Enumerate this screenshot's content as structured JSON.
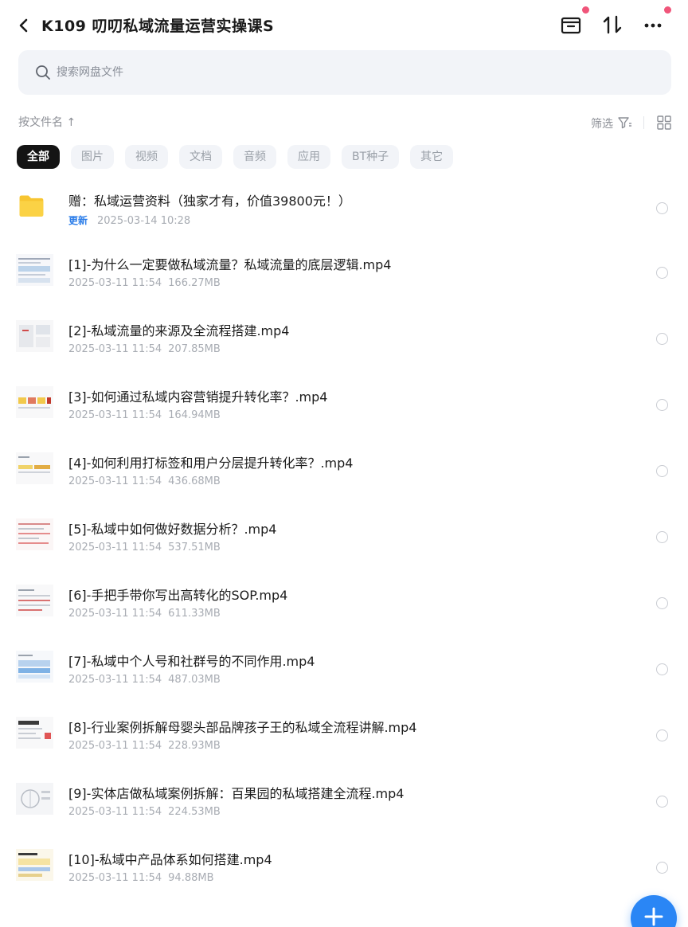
{
  "header": {
    "title": "K109 叨叨私域流量运营实操课S",
    "icons": [
      "back-arrow-icon",
      "archive-box-icon",
      "sort-arrows-icon",
      "more-dots-icon"
    ],
    "badge_color": "#f0557a"
  },
  "search": {
    "placeholder": "搜索网盘文件",
    "value": ""
  },
  "toolbar": {
    "sort_label": "按文件名 ↑",
    "filter_label": "筛选"
  },
  "chips": [
    {
      "label": "全部",
      "active": true
    },
    {
      "label": "图片",
      "active": false
    },
    {
      "label": "视频",
      "active": false
    },
    {
      "label": "文档",
      "active": false
    },
    {
      "label": "音频",
      "active": false
    },
    {
      "label": "应用",
      "active": false
    },
    {
      "label": "BT种子",
      "active": false
    },
    {
      "label": "其它",
      "active": false
    }
  ],
  "folder": {
    "name": "赠：私域运营资料（独家才有，价值39800元！）",
    "tag": "更新",
    "time": "2025-03-14  10:28"
  },
  "files": [
    {
      "name": "[1]-为什么一定要做私域流量？私域流量的底层逻辑.mp4",
      "date": "2025-03-11  11:54",
      "size": "166.27MB"
    },
    {
      "name": "[2]-私域流量的来源及全流程搭建.mp4",
      "date": "2025-03-11  11:54",
      "size": "207.85MB"
    },
    {
      "name": "[3]-如何通过私域内容营销提升转化率？.mp4",
      "date": "2025-03-11  11:54",
      "size": "164.94MB"
    },
    {
      "name": "[4]-如何利用打标签和用户分层提升转化率？.mp4",
      "date": "2025-03-11  11:54",
      "size": "436.68MB"
    },
    {
      "name": "[5]-私域中如何做好数据分析？.mp4",
      "date": "2025-03-11  11:54",
      "size": "537.51MB"
    },
    {
      "name": "[6]-手把手带你写出高转化的SOP.mp4",
      "date": "2025-03-11  11:54",
      "size": "611.33MB"
    },
    {
      "name": "[7]-私域中个人号和社群号的不同作用.mp4",
      "date": "2025-03-11  11:54",
      "size": "487.03MB"
    },
    {
      "name": "[8]-行业案例拆解母婴头部品牌孩子王的私域全流程讲解.mp4",
      "date": "2025-03-11  11:54",
      "size": "228.93MB"
    },
    {
      "name": "[9]-实体店做私域案例拆解：百果园的私域搭建全流程.mp4",
      "date": "2025-03-11  11:54",
      "size": "224.53MB"
    },
    {
      "name": "[10]-私域中产品体系如何搭建.mp4",
      "date": "2025-03-11  11:54",
      "size": "94.88MB"
    }
  ],
  "fab": {
    "icon": "plus-icon",
    "color": "#2a86f5"
  }
}
